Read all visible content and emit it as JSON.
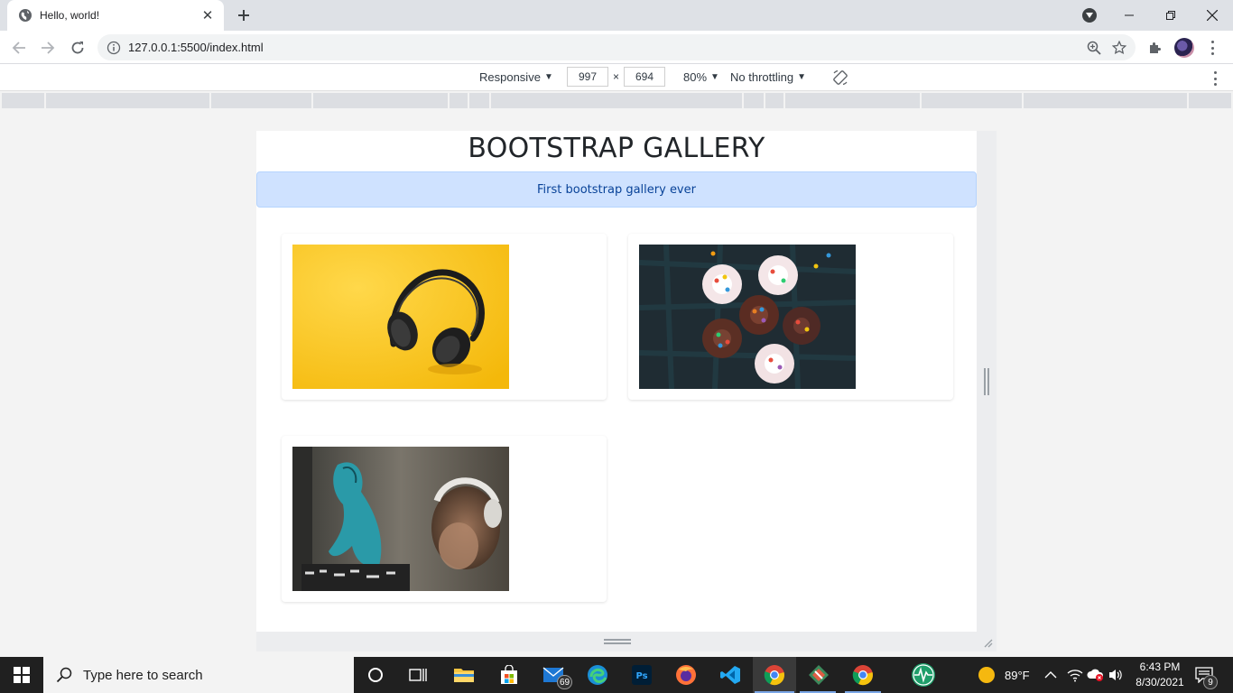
{
  "browser": {
    "tab_title": "Hello, world!",
    "url": "127.0.0.1:5500/index.html"
  },
  "devtools": {
    "device": "Responsive",
    "width": "997",
    "times": "×",
    "height": "694",
    "zoom": "80%",
    "throttling": "No throttling"
  },
  "page": {
    "heading": "BOOTSTRAP GALLERY",
    "alert": "First bootstrap gallery ever",
    "images": [
      {
        "subject": "headphones on yellow background"
      },
      {
        "subject": "cupcakes with sprinkles"
      },
      {
        "subject": "woman with headphones by graffiti wall"
      }
    ],
    "accent_alert_bg": "#cfe2ff",
    "accent_alert_text": "#084298"
  },
  "taskbar": {
    "search_placeholder": "Type here to search",
    "mail_badge": "69",
    "weather": "89°F",
    "time": "6:43 PM",
    "date": "8/30/2021",
    "notification_count": "9"
  }
}
